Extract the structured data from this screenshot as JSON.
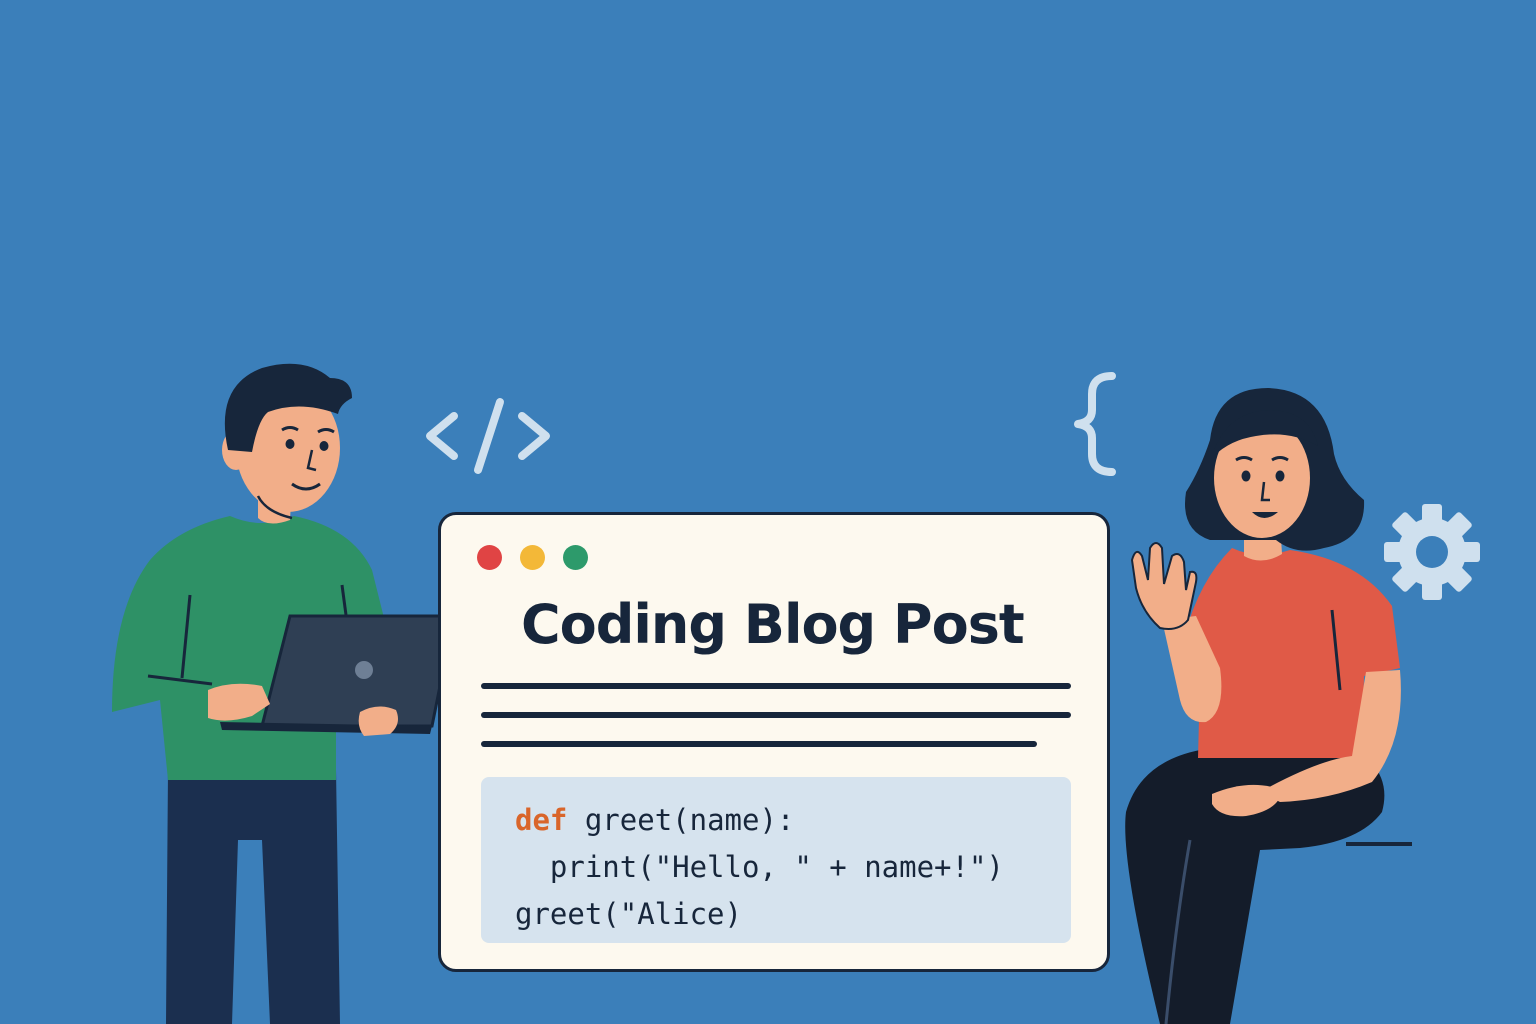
{
  "window": {
    "title": "Coding Blog Post",
    "controls": [
      "close-dot",
      "minimize-dot",
      "maximize-dot"
    ]
  },
  "code": {
    "line1_keyword": "def",
    "line1_rest": " greet(name):",
    "line2": "  print(\"Hello, \" + name+!\")",
    "line3": "greet(\"Alice)"
  },
  "decorations": {
    "tag_symbol": "</>",
    "brace_symbol": "{",
    "icons": [
      "code-tag-icon",
      "curly-brace-icon",
      "gear-icon",
      "laptop-icon"
    ]
  },
  "colors": {
    "background": "#3b7fba",
    "window": "#fdf9ef",
    "code_bg": "#d6e3ee",
    "keyword": "#d9652a",
    "dark": "#17263b",
    "shirt_man": "#2e9166",
    "shirt_woman": "#e05a47"
  }
}
